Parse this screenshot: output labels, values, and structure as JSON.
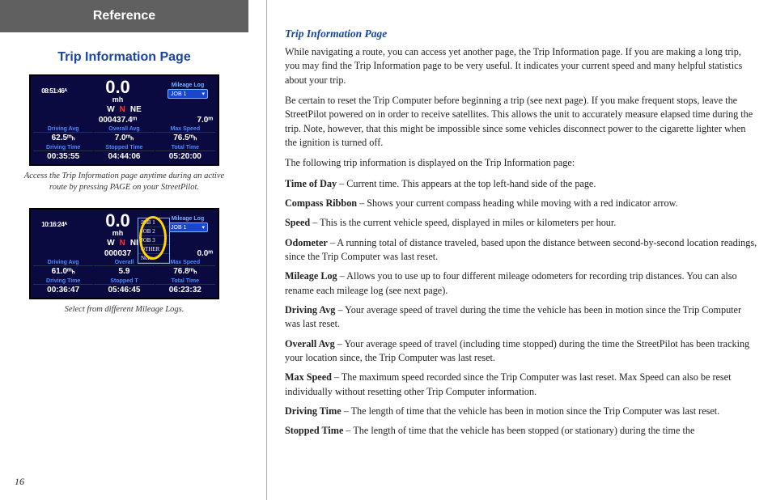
{
  "leftCol": {
    "banner": "Reference",
    "title": "Trip Information Page",
    "screenshot1": {
      "time": "08:51:46ᴬ",
      "speed": "0.0",
      "speedUnit": "mh",
      "mileageLogHdr": "Mileage Log",
      "mileageBtn": "JOB 1",
      "compass": [
        "W",
        "N",
        "NE"
      ],
      "odometer": "000437.4ᵐ",
      "mileageVal": "7.0ᵐ",
      "hdr1": "Driving Avg",
      "hdr2": "Overall Avg",
      "hdr3": "Max Speed",
      "v1": "62.5ᵐₕ",
      "v2": "7.0ᵐₕ",
      "v3": "76.5ᵐₕ",
      "hdr4": "Driving Time",
      "hdr5": "Stopped Time",
      "hdr6": "Total Time",
      "v4": "00:35:55",
      "v5": "04:44:06",
      "v6": "05:20:00"
    },
    "caption1": "Access the Trip Information page anytime during an active route by pressing PAGE on your StreetPilot.",
    "screenshot2": {
      "time": "10:16:24ᴬ",
      "speed": "0.0",
      "speedUnit": "mh",
      "mileageLogHdr": "Mileage Log",
      "mileageBtn": "JOB 1",
      "dropdown": [
        "JOB 1",
        "JOB 2",
        "JOB 3",
        "OTHER",
        "None"
      ],
      "compass": [
        "W",
        "N",
        "NE"
      ],
      "odometer": "000037",
      "mileageVal": "0.0ᵐ",
      "hdr1": "Driving Avg",
      "hdr2": "Overall",
      "hdr3": "Max Speed",
      "v1": "61.0ᵐₕ",
      "v2": "5.9",
      "v3": "76.8ᵐₕ",
      "hdr4": "Driving Time",
      "hdr5": "Stopped T",
      "hdr6": "Total Time",
      "v4": "00:36:47",
      "v5": "05:46:45",
      "v6": "06:23:32"
    },
    "caption2": "Select from different Mileage Logs.",
    "pageNumber": "16"
  },
  "rightCol": {
    "title": "Trip Information Page",
    "p1": "While navigating a route, you can access yet another page, the Trip Information page. If you are making a long trip, you may find the Trip Information page to be very useful. It indicates your current speed and many helpful statistics about your trip.",
    "p2": "Be certain to reset the Trip Computer before beginning a trip (see next page). If you make frequent stops, leave the StreetPilot powered on in order to receive satellites. This allows the unit to accurately measure elapsed time during the trip. Note, however, that this might be impossible since some vehicles disconnect power to the cigarette lighter when the ignition is turned off.",
    "p3": "The following trip information is displayed on the Trip Information page:",
    "defs": [
      {
        "t": "Time of Day",
        "d": " – Current time. This appears at the top left-hand side of the page."
      },
      {
        "t": "Compass Ribbon",
        "d": " – Shows your current compass heading while moving with a red indicator arrow."
      },
      {
        "t": "Speed",
        "d": " – This is the current vehicle speed, displayed in miles or kilometers per hour."
      },
      {
        "t": "Odometer",
        "d": " – A running total of distance traveled, based upon the distance between second-by-second location readings, since the Trip Computer was last reset."
      },
      {
        "t": "Mileage Log",
        "d": " – Allows you to use up to four different mileage odometers for recording trip distances. You can also rename each mileage log (see next page)."
      },
      {
        "t": "Driving Avg",
        "d": " – Your average speed of travel during the time the vehicle has been in motion since the Trip Computer was last reset."
      },
      {
        "t": "Overall Avg",
        "d": " – Your average speed of travel (including time stopped) during the time the StreetPilot has been tracking your location since, the Trip Computer was last reset."
      },
      {
        "t": "Max Speed",
        "d": " – The maximum speed recorded since the Trip Computer was last reset. Max Speed can also be reset individually without resetting other Trip Computer information."
      },
      {
        "t": "Driving Time",
        "d": " – The length of time that the vehicle has been in motion since the Trip Computer was last reset."
      },
      {
        "t": "Stopped Time",
        "d": " – The length of time that the vehicle has been stopped (or stationary) during the time the"
      }
    ]
  }
}
